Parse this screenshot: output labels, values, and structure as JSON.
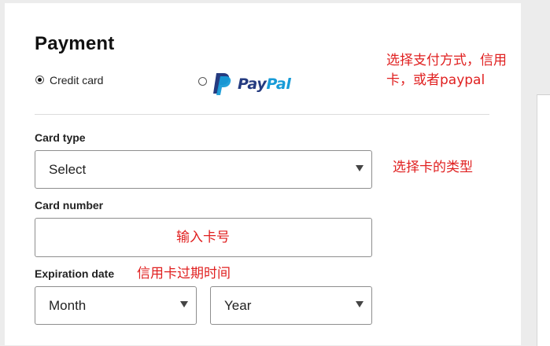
{
  "form": {
    "title": "Payment",
    "payment_methods": [
      {
        "label": "Credit card",
        "selected": true
      },
      {
        "label": "PayPal",
        "selected": false
      }
    ],
    "paypal_logo": {
      "pay": "Pay",
      "pal": "Pal"
    },
    "card_type": {
      "label": "Card type",
      "value": "Select"
    },
    "card_number": {
      "label": "Card number",
      "value": "",
      "placeholder": ""
    },
    "expiration": {
      "label": "Expiration date",
      "month": "Month",
      "year": "Year"
    }
  },
  "annotations": {
    "payment_method_line1": "选择支付方式，信用",
    "payment_method_line2": "卡，或者paypal",
    "card_type": "选择卡的类型",
    "card_number": "输入卡号",
    "expiration": "信用卡过期时间"
  },
  "colors": {
    "annotation_red": "#e02020",
    "paypal_dark_blue": "#253b80",
    "paypal_light_blue": "#179bd7"
  }
}
